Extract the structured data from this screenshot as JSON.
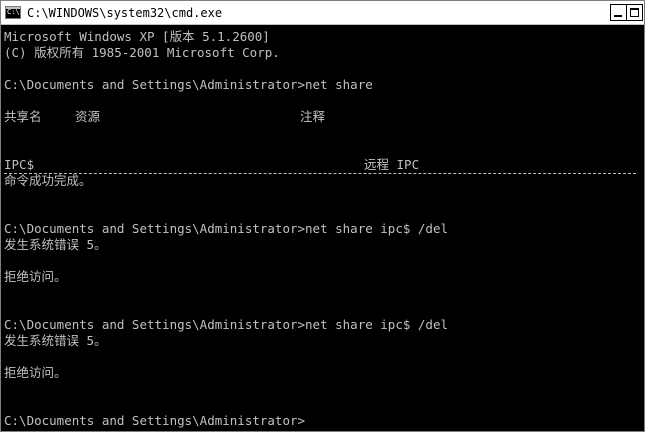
{
  "window": {
    "title": "C:\\WINDOWS\\system32\\cmd.exe",
    "icon_name": "cmd-app-icon",
    "icon_label": "C:\\",
    "buttons": [
      "minimize",
      "maximize"
    ]
  },
  "colors": {
    "console_bg": "#000000",
    "console_fg": "#c0c0c0",
    "titlebar_bg": "#ffffff"
  },
  "console": {
    "banner": {
      "line1": "Microsoft Windows XP [版本 5.1.2600]",
      "line2": "(C) 版权所有 1985-2001 Microsoft Corp."
    },
    "cmd1": "C:\\Documents and Settings\\Administrator>net share",
    "header": {
      "share_name": "共享名",
      "resource": "资源",
      "remark": "注释"
    },
    "share_row": {
      "name": "IPC$",
      "remark": "远程 IPC"
    },
    "success": "命令成功完成。",
    "cmd2": "C:\\Documents and Settings\\Administrator>net share ipc$ /del",
    "error1": "发生系统错误 5。",
    "denied1": "拒绝访问。",
    "cmd3": "C:\\Documents and Settings\\Administrator>net share ipc$ /del",
    "error2": "发生系统错误 5。",
    "denied2": "拒绝访问。",
    "prompt": "C:\\Documents and Settings\\Administrator>"
  }
}
